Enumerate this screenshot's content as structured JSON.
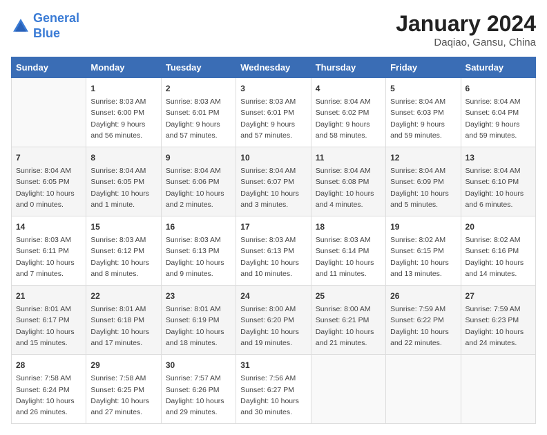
{
  "logo": {
    "line1": "General",
    "line2": "Blue"
  },
  "title": "January 2024",
  "subtitle": "Daqiao, Gansu, China",
  "days_of_week": [
    "Sunday",
    "Monday",
    "Tuesday",
    "Wednesday",
    "Thursday",
    "Friday",
    "Saturday"
  ],
  "weeks": [
    [
      {
        "day": "",
        "info": ""
      },
      {
        "day": "1",
        "info": "Sunrise: 8:03 AM\nSunset: 6:00 PM\nDaylight: 9 hours\nand 56 minutes."
      },
      {
        "day": "2",
        "info": "Sunrise: 8:03 AM\nSunset: 6:01 PM\nDaylight: 9 hours\nand 57 minutes."
      },
      {
        "day": "3",
        "info": "Sunrise: 8:03 AM\nSunset: 6:01 PM\nDaylight: 9 hours\nand 57 minutes."
      },
      {
        "day": "4",
        "info": "Sunrise: 8:04 AM\nSunset: 6:02 PM\nDaylight: 9 hours\nand 58 minutes."
      },
      {
        "day": "5",
        "info": "Sunrise: 8:04 AM\nSunset: 6:03 PM\nDaylight: 9 hours\nand 59 minutes."
      },
      {
        "day": "6",
        "info": "Sunrise: 8:04 AM\nSunset: 6:04 PM\nDaylight: 9 hours\nand 59 minutes."
      }
    ],
    [
      {
        "day": "7",
        "info": "Sunrise: 8:04 AM\nSunset: 6:05 PM\nDaylight: 10 hours\nand 0 minutes."
      },
      {
        "day": "8",
        "info": "Sunrise: 8:04 AM\nSunset: 6:05 PM\nDaylight: 10 hours\nand 1 minute."
      },
      {
        "day": "9",
        "info": "Sunrise: 8:04 AM\nSunset: 6:06 PM\nDaylight: 10 hours\nand 2 minutes."
      },
      {
        "day": "10",
        "info": "Sunrise: 8:04 AM\nSunset: 6:07 PM\nDaylight: 10 hours\nand 3 minutes."
      },
      {
        "day": "11",
        "info": "Sunrise: 8:04 AM\nSunset: 6:08 PM\nDaylight: 10 hours\nand 4 minutes."
      },
      {
        "day": "12",
        "info": "Sunrise: 8:04 AM\nSunset: 6:09 PM\nDaylight: 10 hours\nand 5 minutes."
      },
      {
        "day": "13",
        "info": "Sunrise: 8:04 AM\nSunset: 6:10 PM\nDaylight: 10 hours\nand 6 minutes."
      }
    ],
    [
      {
        "day": "14",
        "info": "Sunrise: 8:03 AM\nSunset: 6:11 PM\nDaylight: 10 hours\nand 7 minutes."
      },
      {
        "day": "15",
        "info": "Sunrise: 8:03 AM\nSunset: 6:12 PM\nDaylight: 10 hours\nand 8 minutes."
      },
      {
        "day": "16",
        "info": "Sunrise: 8:03 AM\nSunset: 6:13 PM\nDaylight: 10 hours\nand 9 minutes."
      },
      {
        "day": "17",
        "info": "Sunrise: 8:03 AM\nSunset: 6:13 PM\nDaylight: 10 hours\nand 10 minutes."
      },
      {
        "day": "18",
        "info": "Sunrise: 8:03 AM\nSunset: 6:14 PM\nDaylight: 10 hours\nand 11 minutes."
      },
      {
        "day": "19",
        "info": "Sunrise: 8:02 AM\nSunset: 6:15 PM\nDaylight: 10 hours\nand 13 minutes."
      },
      {
        "day": "20",
        "info": "Sunrise: 8:02 AM\nSunset: 6:16 PM\nDaylight: 10 hours\nand 14 minutes."
      }
    ],
    [
      {
        "day": "21",
        "info": "Sunrise: 8:01 AM\nSunset: 6:17 PM\nDaylight: 10 hours\nand 15 minutes."
      },
      {
        "day": "22",
        "info": "Sunrise: 8:01 AM\nSunset: 6:18 PM\nDaylight: 10 hours\nand 17 minutes."
      },
      {
        "day": "23",
        "info": "Sunrise: 8:01 AM\nSunset: 6:19 PM\nDaylight: 10 hours\nand 18 minutes."
      },
      {
        "day": "24",
        "info": "Sunrise: 8:00 AM\nSunset: 6:20 PM\nDaylight: 10 hours\nand 19 minutes."
      },
      {
        "day": "25",
        "info": "Sunrise: 8:00 AM\nSunset: 6:21 PM\nDaylight: 10 hours\nand 21 minutes."
      },
      {
        "day": "26",
        "info": "Sunrise: 7:59 AM\nSunset: 6:22 PM\nDaylight: 10 hours\nand 22 minutes."
      },
      {
        "day": "27",
        "info": "Sunrise: 7:59 AM\nSunset: 6:23 PM\nDaylight: 10 hours\nand 24 minutes."
      }
    ],
    [
      {
        "day": "28",
        "info": "Sunrise: 7:58 AM\nSunset: 6:24 PM\nDaylight: 10 hours\nand 26 minutes."
      },
      {
        "day": "29",
        "info": "Sunrise: 7:58 AM\nSunset: 6:25 PM\nDaylight: 10 hours\nand 27 minutes."
      },
      {
        "day": "30",
        "info": "Sunrise: 7:57 AM\nSunset: 6:26 PM\nDaylight: 10 hours\nand 29 minutes."
      },
      {
        "day": "31",
        "info": "Sunrise: 7:56 AM\nSunset: 6:27 PM\nDaylight: 10 hours\nand 30 minutes."
      },
      {
        "day": "",
        "info": ""
      },
      {
        "day": "",
        "info": ""
      },
      {
        "day": "",
        "info": ""
      }
    ]
  ]
}
